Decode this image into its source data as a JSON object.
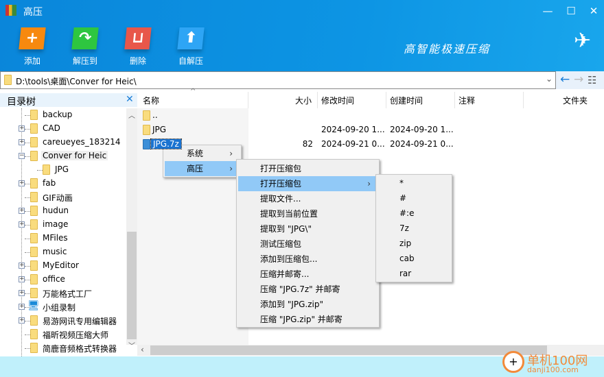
{
  "window": {
    "title": "高压",
    "slogan": "高智能极速压缩",
    "controls": {
      "minimize": "—",
      "maximize": "☐",
      "close": "✕"
    }
  },
  "toolbar": [
    {
      "label": "添加",
      "icon": "plus-icon",
      "glyph": "+",
      "color": "#f7890f"
    },
    {
      "label": "解压到",
      "icon": "extract-arrow-icon",
      "glyph": "↷",
      "color": "#2ec640"
    },
    {
      "label": "删除",
      "icon": "trash-icon",
      "glyph": "⊔",
      "color": "#e8574a"
    },
    {
      "label": "自解压",
      "icon": "upload-arrow-icon",
      "glyph": "⬆",
      "color": "#2ea5f5"
    }
  ],
  "address": {
    "path": "D:\\tools\\桌面\\Conver for Heic\\"
  },
  "tree": {
    "title": "目录树",
    "close": "✕",
    "items": [
      {
        "label": "backup",
        "expander": "",
        "icon": "drive"
      },
      {
        "label": "CAD",
        "expander": "+"
      },
      {
        "label": "careueyes_183214",
        "expander": "+"
      },
      {
        "label": "Conver for Heic",
        "expander": "−",
        "selected": true
      },
      {
        "label": "JPG",
        "expander": "",
        "child": true
      },
      {
        "label": "fab",
        "expander": "+"
      },
      {
        "label": "GIF动画",
        "expander": ""
      },
      {
        "label": "hudun",
        "expander": "+"
      },
      {
        "label": "image",
        "expander": "+"
      },
      {
        "label": "MFiles",
        "expander": ""
      },
      {
        "label": "music",
        "expander": ""
      },
      {
        "label": "MyEditor",
        "expander": "+"
      },
      {
        "label": "office",
        "expander": "+"
      },
      {
        "label": "万能格式工厂",
        "expander": "+"
      },
      {
        "label": "小组录制",
        "expander": "+",
        "icon": "computer"
      },
      {
        "label": "易游网讯专用编辑器",
        "expander": "+"
      },
      {
        "label": "福昕视频压缩大师",
        "expander": ""
      },
      {
        "label": "简鹿音频格式转换器",
        "expander": ""
      }
    ]
  },
  "columns": {
    "name": "名称",
    "size": "大小",
    "modified": "修改时间",
    "created": "创建时间",
    "comment": "注释",
    "folder": "文件夹"
  },
  "files": [
    {
      "name": "..",
      "size": "",
      "modified": "",
      "created": ""
    },
    {
      "name": "JPG",
      "size": "",
      "modified": "2024-09-20 1...",
      "created": "2024-09-20 1..."
    },
    {
      "name": "JPG.7z",
      "size": "82",
      "modified": "2024-09-21 0...",
      "created": "2024-09-21 0...",
      "selected": true
    }
  ],
  "menu1": [
    "系统",
    "高压"
  ],
  "menu2": [
    "打开压缩包",
    "打开压缩包",
    "提取文件...",
    "提取到当前位置",
    "提取到 \"JPG\\\"",
    "测试压缩包",
    "添加到压缩包...",
    "压缩并邮寄...",
    "压缩 \"JPG.7z\" 并邮寄",
    "添加到 \"JPG.zip\"",
    "压缩 \"JPG.zip\" 并邮寄"
  ],
  "menu3": [
    "*",
    "#",
    "#:e",
    "7z",
    "zip",
    "cab",
    "rar"
  ],
  "watermark": {
    "cn": "单机100网",
    "url": "danji100.com"
  },
  "colors": {
    "titlebar": "#0d8fe0",
    "highlight": "#91c9f7",
    "status": "#c0f0fb"
  }
}
